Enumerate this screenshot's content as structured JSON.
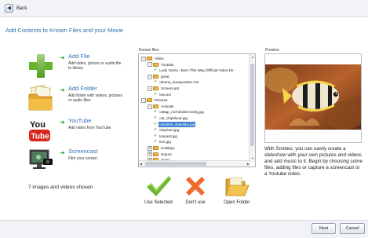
{
  "header": {
    "back_label": "Back"
  },
  "page": {
    "heading": "Add Contents to Known Files and your Movie",
    "chosen_text": "7 images and videos chosen"
  },
  "actions": [
    {
      "title": "Add File",
      "desc": "Add video, picture or audio file to library",
      "icon": "green-plus-icon"
    },
    {
      "title": "Add Folder",
      "desc": "Add folder with videos, pictures or audio files",
      "icon": "folder-files-icon"
    },
    {
      "title": "YouTube",
      "desc": "Add video from YouTube",
      "icon": "youtube-icon"
    },
    {
      "title": "Screencast",
      "desc": "Film your screen",
      "icon": "screencast-icon"
    }
  ],
  "known_files": {
    "label": "Known files",
    "tree": [
      {
        "label": "Video",
        "type": "folder",
        "exp": "-"
      },
      {
        "label": "Youtube",
        "type": "folder",
        "exp": "-"
      },
      {
        "label": "Lady GaGa - Born This Way (Official Video De",
        "type": "file"
      },
      {
        "label": "great",
        "type": "folder",
        "exp": "-"
      },
      {
        "label": "obama_inauguration.AVI",
        "type": "file"
      },
      {
        "label": "Screencast",
        "type": "folder",
        "exp": "-"
      },
      {
        "label": "test.avi",
        "type": "file"
      },
      {
        "label": "Pictures",
        "type": "folder",
        "exp": "-"
      },
      {
        "label": "Animals",
        "type": "folder",
        "exp": "-"
      },
      {
        "label": "cattap_nicholaskennedy.jpg",
        "type": "file"
      },
      {
        "label": "cat_chipshear.jpg",
        "type": "file"
      },
      {
        "label": "colorfish_diversiko.jpg",
        "type": "file",
        "selected": true
      },
      {
        "label": "elephant.jpg",
        "type": "file"
      },
      {
        "label": "leopard.jpg",
        "type": "file"
      },
      {
        "label": "lion.jpg",
        "type": "file"
      },
      {
        "label": "Holidays",
        "type": "folder",
        "exp": "+"
      },
      {
        "label": "Nature",
        "type": "folder",
        "exp": "+"
      },
      {
        "label": "Sport",
        "type": "folder",
        "exp": "+"
      }
    ]
  },
  "buttons": {
    "use_selected": "Use Selected",
    "dont_use": "Don't use",
    "open_folder": "Open Folder",
    "next": "Next",
    "cancel": "Cancel"
  },
  "preview": {
    "label": "Preview",
    "info": "With Smideo, you can easily create a slideshow with your own pictures and videos and add music to it. Begin by choosing some files, adding files or capture a screencast or a Youtube video."
  }
}
